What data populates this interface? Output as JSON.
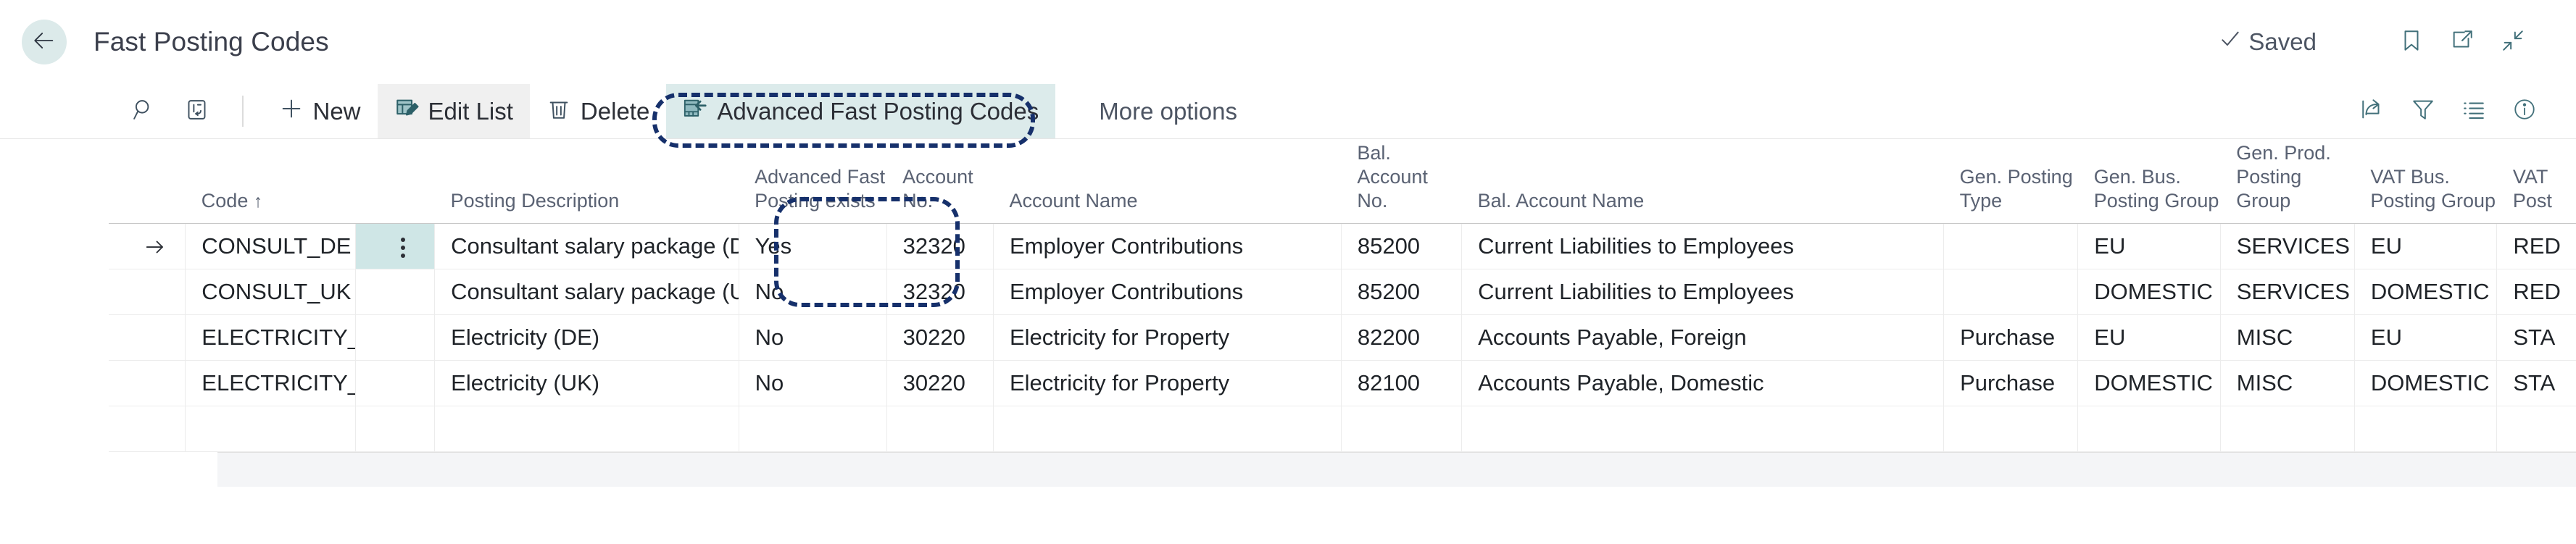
{
  "titlebar": {
    "back_icon": "arrow-left-icon",
    "title": "Fast Posting Codes",
    "saved_label": "Saved",
    "saved_icon": "check-icon",
    "icons": [
      "bookmark-icon",
      "open-in-new-window-icon",
      "collapse-icon"
    ]
  },
  "toolbar": {
    "search_icon": "search-icon",
    "card_icon": "open-in-card-icon",
    "new_label": "New",
    "edit_list_label": "Edit List",
    "delete_label": "Delete",
    "advanced_label": "Advanced Fast Posting Codes",
    "more_options_label": "More options",
    "right_icons": [
      "share-icon",
      "filter-icon",
      "list-icon",
      "info-icon"
    ]
  },
  "grid": {
    "columns": [
      {
        "label": "Code",
        "sort": "↑"
      },
      {
        "label": "Posting Description",
        "sort": ""
      },
      {
        "label": "Advanced Fast\nPosting exists",
        "sort": ""
      },
      {
        "label": "Account\nNo.",
        "sort": ""
      },
      {
        "label": "Account Name",
        "sort": ""
      },
      {
        "label": "Bal.\nAccount\nNo.",
        "sort": ""
      },
      {
        "label": "Bal. Account Name",
        "sort": ""
      },
      {
        "label": "Gen. Posting\nType",
        "sort": ""
      },
      {
        "label": "Gen. Bus.\nPosting Group",
        "sort": ""
      },
      {
        "label": "Gen. Prod.\nPosting Group",
        "sort": ""
      },
      {
        "label": "VAT Bus.\nPosting Group",
        "sort": ""
      },
      {
        "label": "VAT\nPost",
        "sort": ""
      }
    ],
    "rows": [
      {
        "selected": true,
        "code": "CONSULT_DE",
        "posting_description": "Consultant salary package (DE)",
        "advanced_exists": "Yes",
        "account_no": "32320",
        "account_name": "Employer Contributions",
        "bal_account_no": "85200",
        "bal_account_name": "Current Liabilities to Employees",
        "gen_posting_type": "",
        "gen_bus_posting_group": "EU",
        "gen_prod_posting_group": "SERVICES",
        "vat_bus_posting_group": "EU",
        "vat_prod_posting_group": "RED"
      },
      {
        "selected": false,
        "code": "CONSULT_UK",
        "posting_description": "Consultant salary package (UK)",
        "advanced_exists": "No",
        "account_no": "32320",
        "account_name": "Employer Contributions",
        "bal_account_no": "85200",
        "bal_account_name": "Current Liabilities to Employees",
        "gen_posting_type": "",
        "gen_bus_posting_group": "DOMESTIC",
        "gen_prod_posting_group": "SERVICES",
        "vat_bus_posting_group": "DOMESTIC",
        "vat_prod_posting_group": "RED"
      },
      {
        "selected": false,
        "code": "ELECTRICITY_DE",
        "posting_description": "Electricity (DE)",
        "advanced_exists": "No",
        "account_no": "30220",
        "account_name": "Electricity for Property",
        "bal_account_no": "82200",
        "bal_account_name": "Accounts Payable, Foreign",
        "gen_posting_type": "Purchase",
        "gen_bus_posting_group": "EU",
        "gen_prod_posting_group": "MISC",
        "vat_bus_posting_group": "EU",
        "vat_prod_posting_group": "STA"
      },
      {
        "selected": false,
        "code": "ELECTRICITY_UK",
        "posting_description": "Electricity (UK)",
        "advanced_exists": "No",
        "account_no": "30220",
        "account_name": "Electricity for Property",
        "bal_account_no": "82100",
        "bal_account_name": "Accounts Payable, Domestic",
        "gen_posting_type": "Purchase",
        "gen_bus_posting_group": "DOMESTIC",
        "gen_prod_posting_group": "MISC",
        "vat_bus_posting_group": "DOMESTIC",
        "vat_prod_posting_group": "STA"
      }
    ]
  },
  "colors": {
    "accent_teal": "#35707a",
    "selection_teal": "#cfe6e6",
    "annotation_blue": "#16306b",
    "header_text": "#5a6273"
  }
}
